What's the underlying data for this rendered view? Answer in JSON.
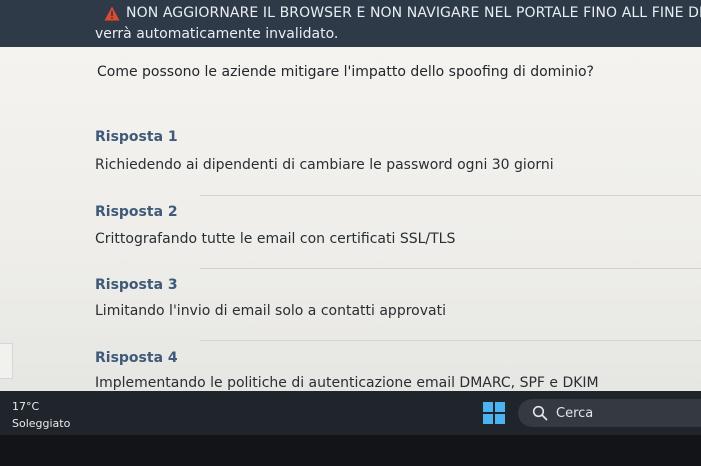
{
  "banner": {
    "warning_text": "NON AGGIORNARE IL BROWSER E NON NAVIGARE NEL PORTALE FINO ALL FINE DELL'ASS",
    "line2": "verrà automaticamente invalidato.",
    "icon": "warning-triangle-icon",
    "icon_color": "#e0492f"
  },
  "quiz": {
    "question": "Come possono le aziende mitigare l'impatto dello spoofing di dominio?",
    "answers": [
      {
        "title": "Risposta 1",
        "text": "Richiedendo ai dipendenti di cambiare le password ogni 30 giorni"
      },
      {
        "title": "Risposta 2",
        "text": "Crittografando tutte le email con certificati SSL/TLS"
      },
      {
        "title": "Risposta 3",
        "text": "Limitando l'invio di email solo a contatti approvati"
      },
      {
        "title": "Risposta 4",
        "text": "Implementando le politiche di autenticazione email DMARC, SPF e DKIM"
      }
    ]
  },
  "taskbar": {
    "temperature": "17°C",
    "condition": "Soleggiato",
    "search_label": "Cerca",
    "start_icon": "windows-start-icon",
    "search_icon": "search-icon"
  },
  "colors": {
    "answer_title": "#3f5a78",
    "banner_bg": "#2e3a47",
    "taskbar_bg": "#20242b",
    "windows_blue": "#4cb3f0"
  }
}
